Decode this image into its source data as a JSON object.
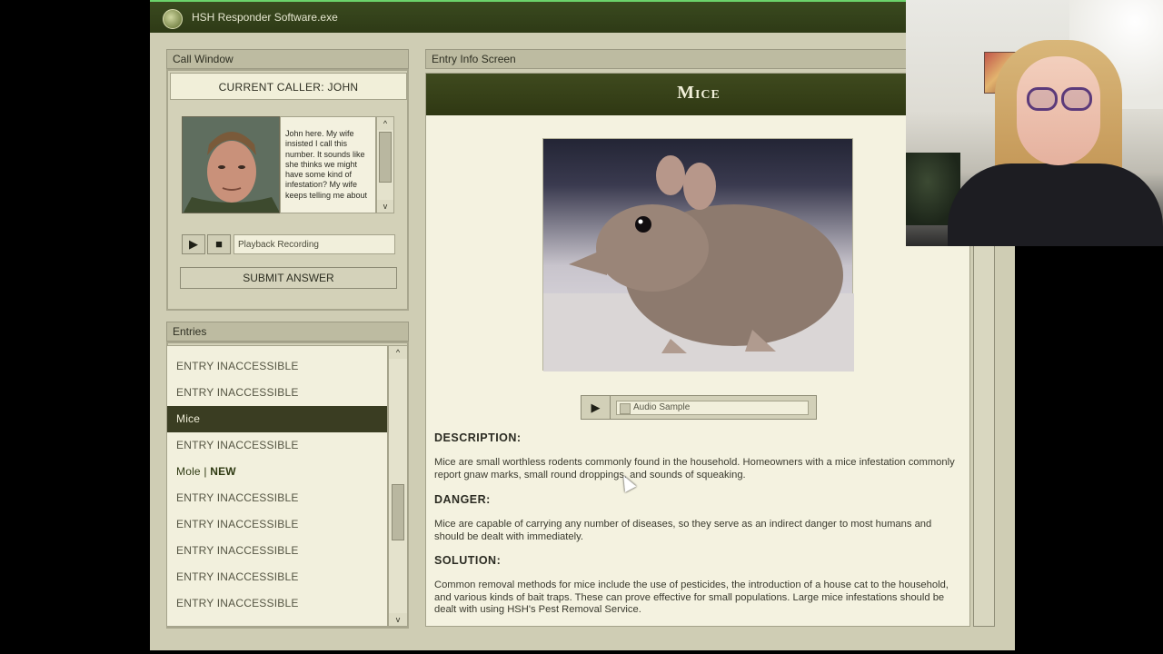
{
  "window": {
    "title": "HSH Responder Software.exe"
  },
  "call_window": {
    "header": "Call Window",
    "current_caller": "CURRENT CALLER: JOHN",
    "transcript": "John here. My wife insisted I call this number. It sounds like she thinks we might have some kind of infestation? My wife keeps telling me about",
    "playback_label": "Playback Recording",
    "submit_label": "SUBMIT ANSWER",
    "play_glyph": "▶",
    "stop_glyph": "■"
  },
  "entries": {
    "header": "Entries",
    "items": [
      {
        "label": "ENTRY INACCESSIBLE",
        "state": "locked"
      },
      {
        "label": "ENTRY INACCESSIBLE",
        "state": "locked"
      },
      {
        "label": "Mice",
        "state": "selected"
      },
      {
        "label": "ENTRY INACCESSIBLE",
        "state": "locked"
      },
      {
        "label": "Mole | ",
        "badge": "NEW",
        "state": "new"
      },
      {
        "label": "ENTRY INACCESSIBLE",
        "state": "locked"
      },
      {
        "label": "ENTRY INACCESSIBLE",
        "state": "locked"
      },
      {
        "label": "ENTRY INACCESSIBLE",
        "state": "locked"
      },
      {
        "label": "ENTRY INACCESSIBLE",
        "state": "locked"
      },
      {
        "label": "ENTRY INACCESSIBLE",
        "state": "locked"
      }
    ]
  },
  "entry_info": {
    "header": "Entry Info Screen",
    "title": "Mice",
    "audio_label": "Audio Sample",
    "description_heading": "DESCRIPTION:",
    "description": "Mice are small worthless rodents commonly found in the household. Homeowners with a mice infestation commonly report gnaw marks, small round droppings, and sounds of squeaking.",
    "danger_heading": "DANGER:",
    "danger": "Mice are capable of carrying any number of diseases, so they serve as an indirect danger to most humans and should be dealt with immediately.",
    "solution_heading": "SOLUTION:",
    "solution": "Common removal methods for mice include the use of pesticides, the introduction of a house cat to the household, and various kinds of bait traps. These can prove effective for small populations. Large mice infestations should be dealt with using HSH's Pest Removal Service."
  },
  "scroll": {
    "up_glyph": "^",
    "down_glyph": "v"
  },
  "colors": {
    "title_bar": "#3a4a1f",
    "selected_entry": "#3a3d22",
    "panel": "#cfcdb4"
  }
}
